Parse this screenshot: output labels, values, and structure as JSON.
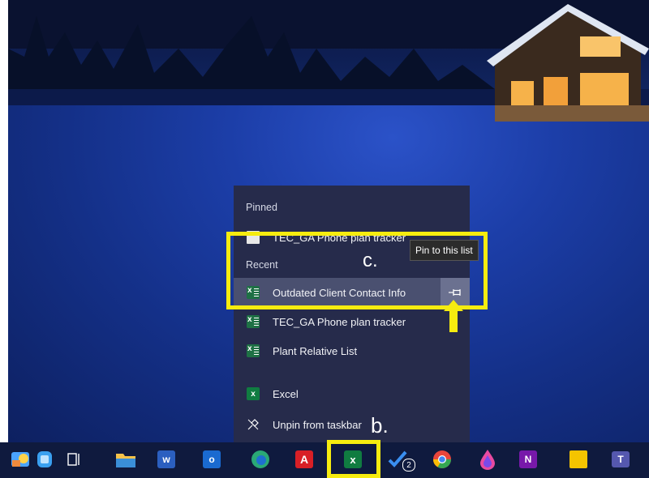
{
  "jumplist": {
    "pinned_header": "Pinned",
    "pinned_items": [
      {
        "label": "TEC_GA Phone plan tracker"
      }
    ],
    "recent_header": "Recent",
    "recent_items": [
      {
        "label": "Outdated Client Contact Info"
      },
      {
        "label": "TEC_GA Phone plan tracker"
      },
      {
        "label": "Plant Relative List"
      }
    ],
    "tasks": [
      {
        "label": "Excel",
        "icon": "excel-icon"
      },
      {
        "label": "Unpin from taskbar",
        "icon": "unpin-icon"
      }
    ],
    "pin_tooltip": "Pin to this list"
  },
  "annotations": {
    "c_label": "c.",
    "b_label": "b."
  },
  "taskbar": {
    "icons": [
      "ms-paint-icon",
      "task-view-icon",
      "file-explorer-icon",
      "word-icon",
      "outlook-icon",
      "edge-icon",
      "acrobat-icon",
      "excel-icon",
      "todo-icon",
      "chrome-icon",
      "paint-drop-icon",
      "onenote-icon",
      "sticky-notes-icon",
      "teams-icon"
    ],
    "todo_badge": "2"
  },
  "colors": {
    "highlight": "#f6ec0f",
    "menu_bg": "#262b4b",
    "excel_green": "#107c41"
  }
}
